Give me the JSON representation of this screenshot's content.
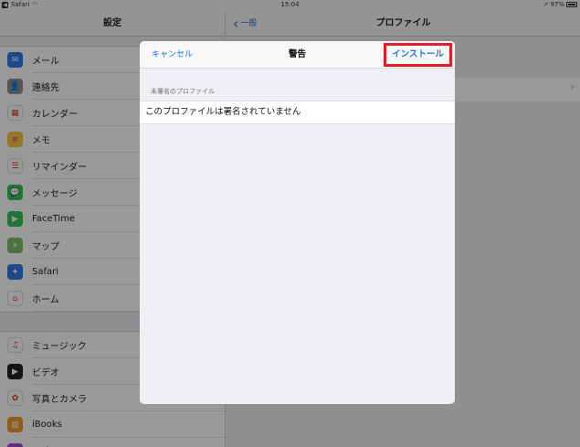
{
  "status_bar": {
    "back_app": "Safari",
    "time": "15:04",
    "battery": "97%"
  },
  "left_pane": {
    "title": "設定",
    "items": [
      {
        "label": "メール",
        "icon": "mail-icon",
        "color": "#2f7be6",
        "glyph": "✉"
      },
      {
        "label": "連絡先",
        "icon": "contacts-icon",
        "color": "#8e8e93",
        "glyph": "👤"
      },
      {
        "label": "カレンダー",
        "icon": "calendar-icon",
        "color": "#ffffff",
        "glyph": "▦"
      },
      {
        "label": "メモ",
        "icon": "notes-icon",
        "color": "#f5c94a",
        "glyph": "≡"
      },
      {
        "label": "リマインダー",
        "icon": "reminders-icon",
        "color": "#ffffff",
        "glyph": "☰"
      },
      {
        "label": "メッセージ",
        "icon": "messages-icon",
        "color": "#35c35a",
        "glyph": "💬"
      },
      {
        "label": "FaceTime",
        "icon": "facetime-icon",
        "color": "#35c35a",
        "glyph": "▶"
      },
      {
        "label": "マップ",
        "icon": "maps-icon",
        "color": "#7fbf6a",
        "glyph": "⌖"
      },
      {
        "label": "Safari",
        "icon": "safari-icon",
        "color": "#2f7be6",
        "glyph": "✦"
      },
      {
        "label": "ホーム",
        "icon": "home-icon",
        "color": "#ffffff",
        "glyph": "⌂"
      }
    ],
    "items2": [
      {
        "label": "ミュージック",
        "icon": "music-icon",
        "color": "#ffffff",
        "glyph": "♫"
      },
      {
        "label": "ビデオ",
        "icon": "videos-icon",
        "color": "#222222",
        "glyph": "▶"
      },
      {
        "label": "写真とカメラ",
        "icon": "photos-icon",
        "color": "#ffffff",
        "glyph": "✿"
      },
      {
        "label": "iBooks",
        "icon": "ibooks-icon",
        "color": "#f19a2c",
        "glyph": "▥"
      },
      {
        "label": "Podcast",
        "icon": "podcast-icon",
        "color": "#9b4fd6",
        "glyph": "◉"
      }
    ]
  },
  "right_pane": {
    "back_label": "一般",
    "title": "プロファイル"
  },
  "modal": {
    "cancel_label": "キャンセル",
    "title": "警告",
    "install_label": "インストール",
    "section_header": "未署名のプロファイル",
    "message": "このプロファイルは署名されていません",
    "highlight_color": "#e11d2a"
  }
}
